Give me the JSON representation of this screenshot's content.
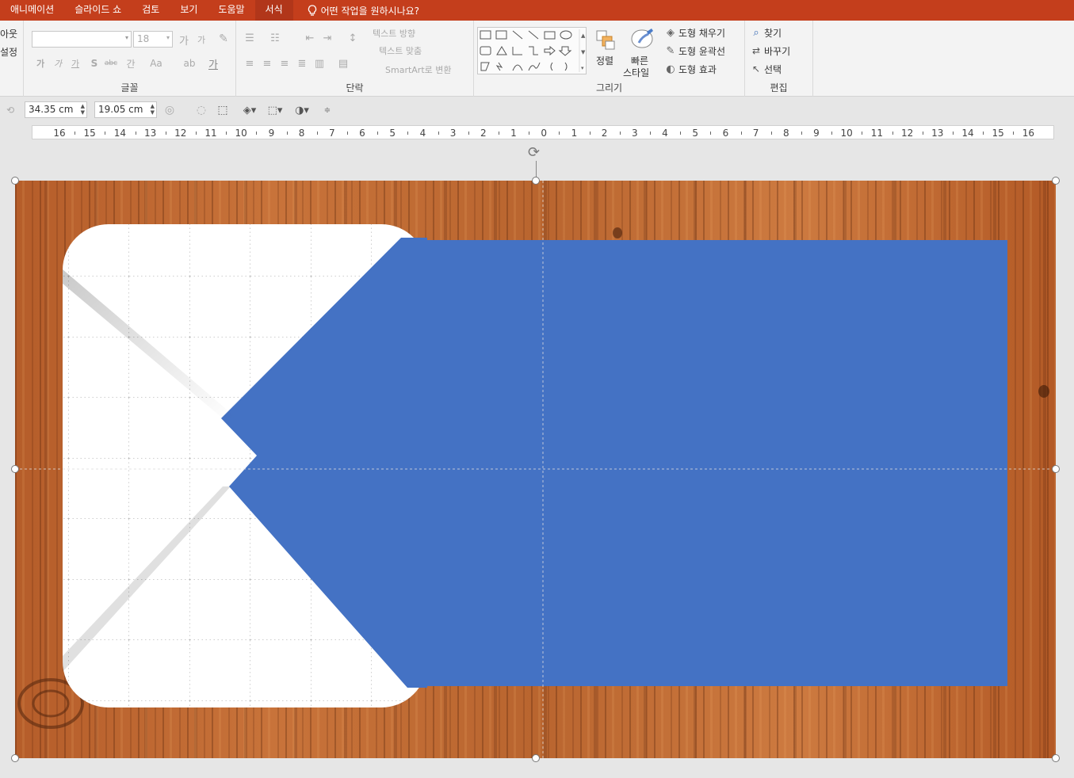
{
  "tabs": [
    {
      "label": "애니메이션",
      "active": false
    },
    {
      "label": "슬라이드 쇼",
      "active": false
    },
    {
      "label": "검토",
      "active": false
    },
    {
      "label": "보기",
      "active": false
    },
    {
      "label": "도움말",
      "active": false
    },
    {
      "label": "서식",
      "active": true
    }
  ],
  "tell_me": "어떤 작업을 원하시나요?",
  "ribbon": {
    "clip_left_top": "아웃",
    "clip_left_bottom": "설정",
    "font": {
      "font_size": "18",
      "label": "글꼴",
      "change_case": "Aa",
      "spacing": "간"
    },
    "paragraph": {
      "text_direction": "텍스트 방향",
      "align_text": "텍스트 맞춤",
      "smartart": "SmartArt로 변환",
      "label": "단락"
    },
    "drawing": {
      "arrange": "정렬",
      "quick_styles_1": "빠른",
      "quick_styles_2": "스타일",
      "shape_fill": "도형 채우기",
      "shape_outline": "도형 윤곽선",
      "shape_effects": "도형 효과",
      "label": "그리기"
    },
    "editing": {
      "find": "찾기",
      "replace": "바꾸기",
      "select": "선택",
      "label": "편집"
    }
  },
  "format_bar": {
    "width": "34.35 cm",
    "height": "19.05 cm"
  },
  "ruler_labels": [
    "16",
    "15",
    "14",
    "13",
    "12",
    "11",
    "10",
    "9",
    "8",
    "7",
    "6",
    "5",
    "4",
    "3",
    "2",
    "1",
    "0",
    "1",
    "2",
    "3",
    "4",
    "5",
    "6",
    "7",
    "8",
    "9",
    "10",
    "11",
    "12",
    "13",
    "14",
    "15",
    "16"
  ],
  "colors": {
    "title_bar": "#c43e1c",
    "blue_shape": "#4472c4",
    "paper": "#ffffff"
  },
  "icons": [
    "lightbulb-icon",
    "find-icon",
    "replace-icon",
    "select-icon",
    "shape-fill-icon",
    "shape-outline-icon",
    "shape-effects-icon",
    "rotate-icon"
  ]
}
